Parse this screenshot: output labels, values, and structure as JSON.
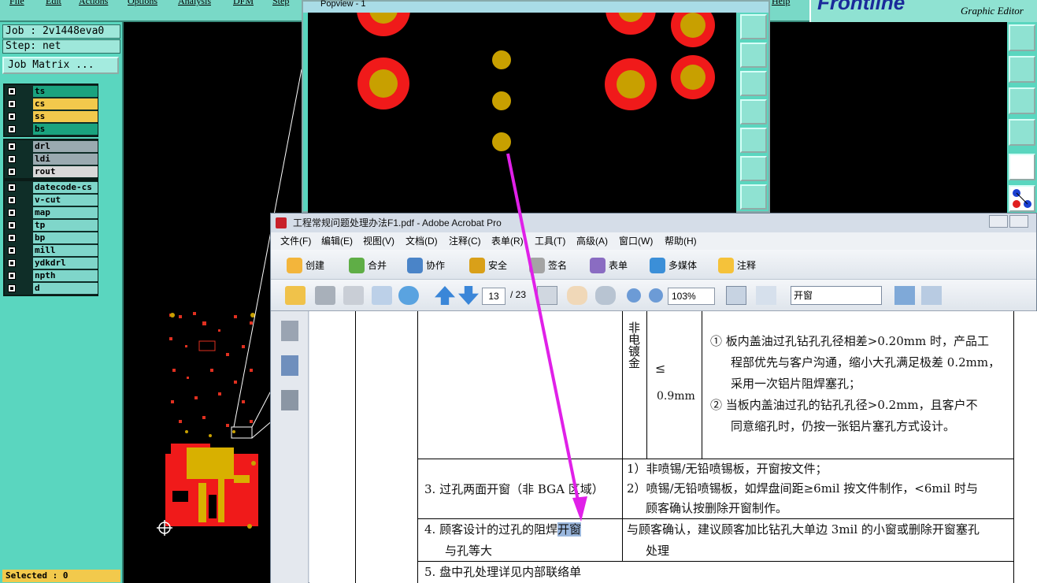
{
  "genesis": {
    "menu": [
      "File",
      "Edit",
      "Actions",
      "Options",
      "Analysis",
      "DFM",
      "Step",
      "Help"
    ],
    "logo_text": "Frontline",
    "logo_subtitle": "Graphic Editor",
    "job_label": "Job : 2v1448eva0",
    "step_label": "Step: net",
    "job_matrix_button": "Job Matrix ...",
    "layer_groups": [
      [
        {
          "name": "ts",
          "color": "#1aa37f"
        },
        {
          "name": "cs",
          "color": "#f2c94c"
        },
        {
          "name": "ss",
          "color": "#f2c94c"
        },
        {
          "name": "bs",
          "color": "#1aa37f"
        }
      ],
      [
        {
          "name": "drl",
          "color": "#9aaab0"
        },
        {
          "name": "ldi",
          "color": "#9aaab0"
        },
        {
          "name": "rout",
          "color": "#d8d8d8"
        }
      ],
      [
        {
          "name": "datecode-cs",
          "color": "#7fd6ca"
        },
        {
          "name": "v-cut",
          "color": "#7fd6ca"
        },
        {
          "name": "map",
          "color": "#7fd6ca"
        },
        {
          "name": "tp",
          "color": "#7fd6ca"
        },
        {
          "name": "bp",
          "color": "#7fd6ca"
        },
        {
          "name": "mill",
          "color": "#7fd6ca"
        },
        {
          "name": "ydkdrl",
          "color": "#7fd6ca"
        },
        {
          "name": "npth",
          "color": "#7fd6ca"
        },
        {
          "name": "d",
          "color": "#7fd6ca"
        }
      ]
    ],
    "selected_label": "Selected : 0",
    "popview_title": "Popview - 1"
  },
  "acrobat": {
    "window_title": "工程常规问题处理办法F1.pdf - Adobe Acrobat Pro",
    "menu": [
      "文件(F)",
      "编辑(E)",
      "视图(V)",
      "文档(D)",
      "注释(C)",
      "表单(R)",
      "工具(T)",
      "高级(A)",
      "窗口(W)",
      "帮助(H)"
    ],
    "tasks": [
      "创建",
      "合并",
      "协作",
      "安全",
      "签名",
      "表单",
      "多媒体",
      "注释"
    ],
    "page_current": "13",
    "page_total": "/ 23",
    "zoom": "103%",
    "search_text": "开窗"
  },
  "document": {
    "row1": {
      "type_label": "非电镀金",
      "tolerance": "≤",
      "tolerance_value": "0.9mm",
      "note1": "①  板内盖油过孔钻孔孔径相差>0.20mm 时，产品工",
      "note2": "程部优先与客户沟通，缩小大孔满足极差 0.2mm，",
      "note3": "采用一次铝片阻焊塞孔；",
      "note4": "②  当板内盖油过孔的钻孔孔径>0.2mm，且客户不",
      "note5": "同意缩孔时，仍按一张铝片塞孔方式设计。"
    },
    "row2": {
      "item": "3.  过孔两面开窗（非 BGA 区域）",
      "sol1": "1）非喷锡/无铅喷锡板，开窗按文件；",
      "sol2": "2）喷锡/无铅喷锡板，如焊盘间距≥6mil 按文件制作，<6mil 时与",
      "sol3": "顾客确认按删除开窗制作。"
    },
    "row3": {
      "item_a": "4.  顾客设计的过孔的阻焊",
      "item_hl": "开窗",
      "item_b": "与孔等大",
      "sol1": "与顾客确认，建议顾客加比钻孔大单边 3mil 的小窗或删除开窗塞孔",
      "sol2": "处理"
    },
    "row4": {
      "item": "5.  盘中孔处理详见内部联络单"
    }
  }
}
